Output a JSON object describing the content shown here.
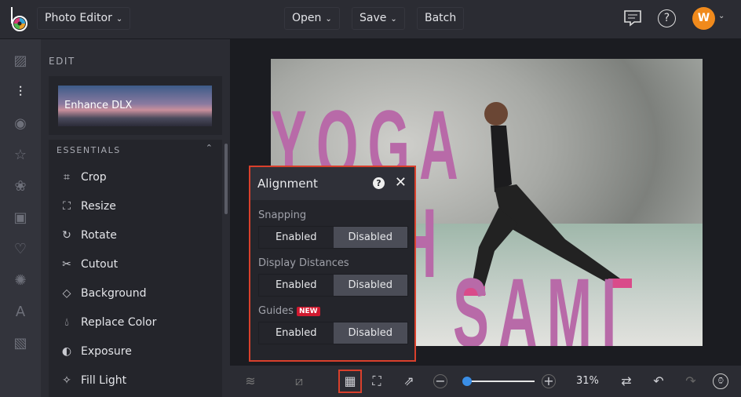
{
  "header": {
    "app_menu": "Photo Editor",
    "open": "Open",
    "save": "Save",
    "batch": "Batch",
    "avatar_initial": "W"
  },
  "sidebar": {
    "section": "EDIT",
    "featured": "Enhance DLX",
    "group": "ESSENTIALS",
    "items": [
      {
        "label": "Crop",
        "icon": "crop-icon"
      },
      {
        "label": "Resize",
        "icon": "resize-icon"
      },
      {
        "label": "Rotate",
        "icon": "rotate-icon"
      },
      {
        "label": "Cutout",
        "icon": "scissors-icon"
      },
      {
        "label": "Background",
        "icon": "background-icon"
      },
      {
        "label": "Replace Color",
        "icon": "droplet-icon"
      },
      {
        "label": "Exposure",
        "icon": "exposure-icon"
      },
      {
        "label": "Fill Light",
        "icon": "fill-light-icon"
      }
    ]
  },
  "canvas": {
    "line1": "YOGA WITH",
    "line2": "SAMI"
  },
  "alignment": {
    "title": "Alignment",
    "snapping": "Snapping",
    "display_distances": "Display Distances",
    "guides": "Guides",
    "new_badge": "NEW",
    "enabled": "Enabled",
    "disabled": "Disabled",
    "selected": "Disabled"
  },
  "toolbar": {
    "zoom": "31%",
    "zoom_fraction": 0.1
  },
  "colors": {
    "accent": "#3a8ee6",
    "highlight": "#d9402c",
    "avatar": "#f08a1c",
    "text_pink": "#b86aa8"
  }
}
